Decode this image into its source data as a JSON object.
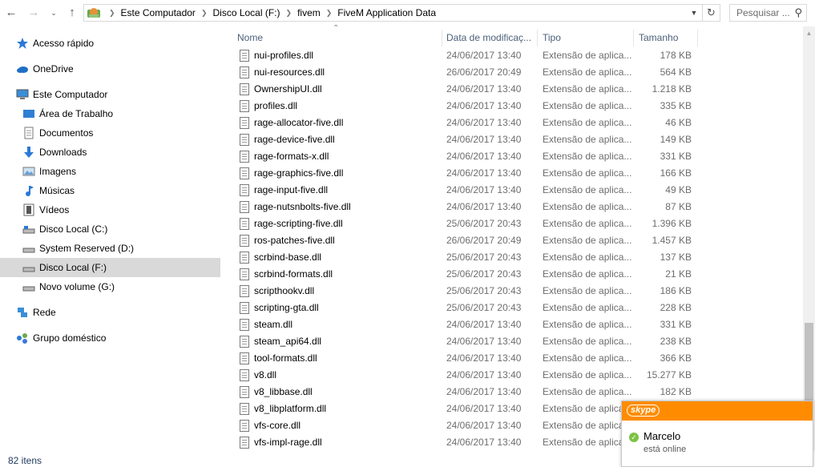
{
  "address_bar": {
    "crumbs": [
      "Este Computador",
      "Disco Local (F:)",
      "fivem",
      "FiveM Application Data"
    ],
    "search_placeholder": "Pesquisar ..."
  },
  "nav": {
    "items": [
      {
        "label": "Acesso rápido",
        "icon": "star-icon"
      },
      {
        "label": "OneDrive",
        "icon": "cloud-icon"
      },
      {
        "label": "Este Computador",
        "icon": "computer-icon"
      },
      {
        "label": "Área de Trabalho",
        "icon": "desktop-icon"
      },
      {
        "label": "Documentos",
        "icon": "document-icon"
      },
      {
        "label": "Downloads",
        "icon": "download-arrow-icon"
      },
      {
        "label": "Imagens",
        "icon": "picture-icon"
      },
      {
        "label": "Músicas",
        "icon": "music-note-icon"
      },
      {
        "label": "Vídeos",
        "icon": "film-icon"
      },
      {
        "label": "Disco Local (C:)",
        "icon": "drive-icon"
      },
      {
        "label": "System Reserved (D:)",
        "icon": "drive-icon"
      },
      {
        "label": "Disco Local (F:)",
        "icon": "drive-icon"
      },
      {
        "label": "Novo volume (G:)",
        "icon": "drive-icon"
      },
      {
        "label": "Rede",
        "icon": "network-icon"
      },
      {
        "label": "Grupo doméstico",
        "icon": "homegroup-icon"
      }
    ],
    "selected": "Disco Local (F:)"
  },
  "columns": {
    "name": "Nome",
    "date": "Data de modificaç...",
    "type": "Tipo",
    "size": "Tamanho"
  },
  "files": [
    {
      "name": "nui-profiles.dll",
      "date": "24/06/2017 13:40",
      "type": "Extensão de aplica...",
      "size": "178 KB"
    },
    {
      "name": "nui-resources.dll",
      "date": "26/06/2017 20:49",
      "type": "Extensão de aplica...",
      "size": "564 KB"
    },
    {
      "name": "OwnershipUI.dll",
      "date": "24/06/2017 13:40",
      "type": "Extensão de aplica...",
      "size": "1.218 KB"
    },
    {
      "name": "profiles.dll",
      "date": "24/06/2017 13:40",
      "type": "Extensão de aplica...",
      "size": "335 KB"
    },
    {
      "name": "rage-allocator-five.dll",
      "date": "24/06/2017 13:40",
      "type": "Extensão de aplica...",
      "size": "46 KB"
    },
    {
      "name": "rage-device-five.dll",
      "date": "24/06/2017 13:40",
      "type": "Extensão de aplica...",
      "size": "149 KB"
    },
    {
      "name": "rage-formats-x.dll",
      "date": "24/06/2017 13:40",
      "type": "Extensão de aplica...",
      "size": "331 KB"
    },
    {
      "name": "rage-graphics-five.dll",
      "date": "24/06/2017 13:40",
      "type": "Extensão de aplica...",
      "size": "166 KB"
    },
    {
      "name": "rage-input-five.dll",
      "date": "24/06/2017 13:40",
      "type": "Extensão de aplica...",
      "size": "49 KB"
    },
    {
      "name": "rage-nutsnbolts-five.dll",
      "date": "24/06/2017 13:40",
      "type": "Extensão de aplica...",
      "size": "87 KB"
    },
    {
      "name": "rage-scripting-five.dll",
      "date": "25/06/2017 20:43",
      "type": "Extensão de aplica...",
      "size": "1.396 KB"
    },
    {
      "name": "ros-patches-five.dll",
      "date": "26/06/2017 20:49",
      "type": "Extensão de aplica...",
      "size": "1.457 KB"
    },
    {
      "name": "scrbind-base.dll",
      "date": "25/06/2017 20:43",
      "type": "Extensão de aplica...",
      "size": "137 KB"
    },
    {
      "name": "scrbind-formats.dll",
      "date": "25/06/2017 20:43",
      "type": "Extensão de aplica...",
      "size": "21 KB"
    },
    {
      "name": "scripthookv.dll",
      "date": "25/06/2017 20:43",
      "type": "Extensão de aplica...",
      "size": "186 KB"
    },
    {
      "name": "scripting-gta.dll",
      "date": "25/06/2017 20:43",
      "type": "Extensão de aplica...",
      "size": "228 KB"
    },
    {
      "name": "steam.dll",
      "date": "24/06/2017 13:40",
      "type": "Extensão de aplica...",
      "size": "331 KB"
    },
    {
      "name": "steam_api64.dll",
      "date": "24/06/2017 13:40",
      "type": "Extensão de aplica...",
      "size": "238 KB"
    },
    {
      "name": "tool-formats.dll",
      "date": "24/06/2017 13:40",
      "type": "Extensão de aplica...",
      "size": "366 KB"
    },
    {
      "name": "v8.dll",
      "date": "24/06/2017 13:40",
      "type": "Extensão de aplica...",
      "size": "15.277 KB"
    },
    {
      "name": "v8_libbase.dll",
      "date": "24/06/2017 13:40",
      "type": "Extensão de aplica...",
      "size": "182 KB"
    },
    {
      "name": "v8_libplatform.dll",
      "date": "24/06/2017 13:40",
      "type": "Extensão de aplica...",
      "size": ""
    },
    {
      "name": "vfs-core.dll",
      "date": "24/06/2017 13:40",
      "type": "Extensão de aplica...",
      "size": ""
    },
    {
      "name": "vfs-impl-rage.dll",
      "date": "24/06/2017 13:40",
      "type": "Extensão de aplica...",
      "size": ""
    }
  ],
  "status": {
    "item_count": "82 itens"
  },
  "toast": {
    "app": "skype",
    "contact": "Marcelo",
    "status": "está online",
    "accent": "#ff8c00"
  }
}
